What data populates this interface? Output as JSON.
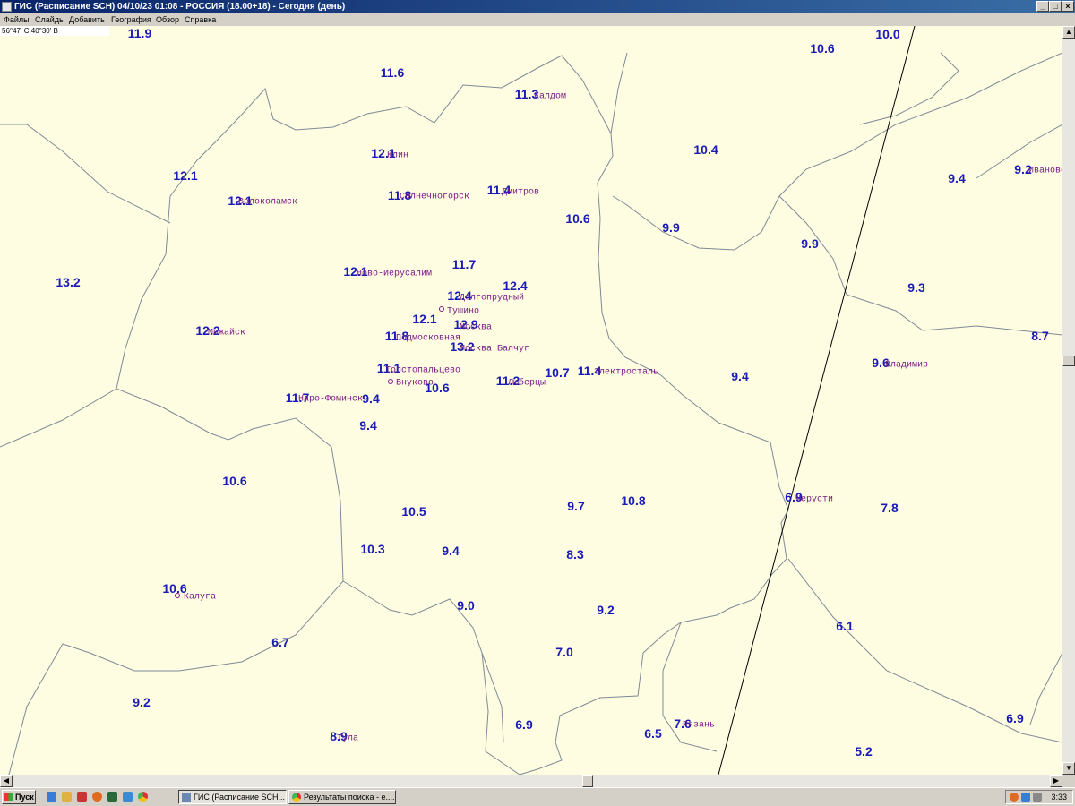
{
  "window": {
    "title": "ГИС (Расписание SCH) 04/10/23 01:08 - РОССИЯ (18.00+18) - Сегодня (день)",
    "buttons": [
      "_",
      "□",
      "×"
    ]
  },
  "menu": [
    "Файлы",
    "Слайды",
    "Добавить",
    "География",
    "Обзор",
    "Справка"
  ],
  "coords_readout": "56°47' С 40°30' В",
  "map": {
    "values": [
      "11.9",
      "10.0",
      "10.6",
      "11.6",
      "11.3",
      "12.1",
      "10.4",
      "12.1",
      "11.4",
      "11.8",
      "12.1",
      "10.6",
      "9.9",
      "9.4",
      "9.2",
      "9.9",
      "13.2",
      "12.1",
      "11.7",
      "12.4",
      "12.4",
      "9.3",
      "12.1",
      "12.9",
      "12.2",
      "11.8",
      "13.2",
      "8.7",
      "9.6",
      "11.1",
      "10.7",
      "11.4",
      "11.2",
      "9.4",
      "10.6",
      "11.7",
      "9.4",
      "9.4",
      "10.6",
      "6.9",
      "9.7",
      "10.8",
      "7.8",
      "10.5",
      "10.3",
      "9.4",
      "8.3",
      "10.6",
      "9.0",
      "9.2",
      "6.7",
      "6.1",
      "7.0",
      "9.2",
      "7.6",
      "8.9",
      "6.9",
      "6.5",
      "6.9",
      "5.2"
    ],
    "cities": [
      "Калдом",
      "Клин",
      "Волоколамск",
      "Солнечногорск",
      "Дмитров",
      "Ново-Иерусалим",
      "Долгопрудный",
      "Тушино",
      "Москва",
      "Можайск",
      "Подмосковная",
      "Москва Балчуг",
      "Толстопальцево",
      "Внуково",
      "Электросталь",
      "Люберцы",
      "Наро-Фоминск",
      "Владимир",
      "Ивановo",
      "Черусти",
      "Калуга",
      "Рязань",
      "Тула"
    ]
  },
  "taskbar": {
    "start": "Пуск",
    "tasks": [
      "ГИС (Расписание SCH...",
      "Результаты поиска - е...."
    ],
    "clock": "3:33"
  }
}
